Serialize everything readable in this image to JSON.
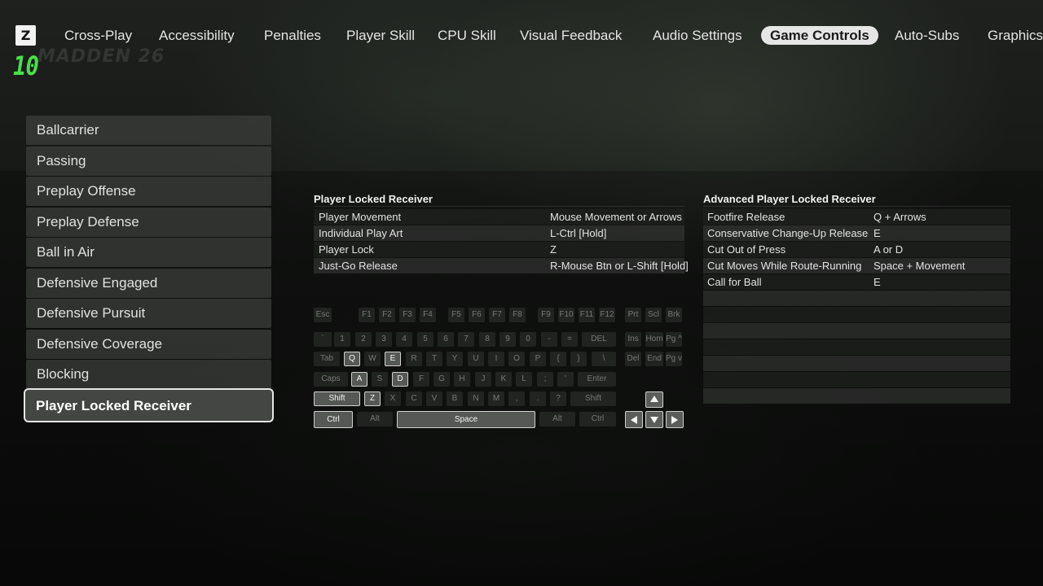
{
  "header": {
    "logo_letter": "Z",
    "score": "10",
    "brand": "MADDEN 26",
    "tabs": [
      {
        "label": "Cross-Play",
        "active": false
      },
      {
        "label": "Accessibility",
        "active": false
      },
      {
        "label": "Penalties",
        "active": false
      },
      {
        "label": "Player Skill",
        "active": false
      },
      {
        "label": "CPU Skill",
        "active": false
      },
      {
        "label": "Visual Feedback",
        "active": false
      },
      {
        "label": "Audio Settings",
        "active": false
      },
      {
        "label": "Game Controls",
        "active": true
      },
      {
        "label": "Auto-Subs",
        "active": false
      },
      {
        "label": "Graphics",
        "active": false
      }
    ]
  },
  "sidebar": {
    "items": [
      {
        "label": "Ballcarrier",
        "selected": false
      },
      {
        "label": "Passing",
        "selected": false
      },
      {
        "label": "Preplay Offense",
        "selected": false
      },
      {
        "label": "Preplay Defense",
        "selected": false
      },
      {
        "label": "Ball in Air",
        "selected": false
      },
      {
        "label": "Defensive Engaged",
        "selected": false
      },
      {
        "label": "Defensive Pursuit",
        "selected": false
      },
      {
        "label": "Defensive Coverage",
        "selected": false
      },
      {
        "label": "Blocking",
        "selected": false
      },
      {
        "label": "Player Locked Receiver",
        "selected": true
      }
    ]
  },
  "controls_main": {
    "title": "Player Locked Receiver",
    "rows": [
      {
        "action": "Player Movement",
        "binding": "Mouse Movement or Arrows"
      },
      {
        "action": "Individual Play Art",
        "binding": "L-Ctrl [Hold]"
      },
      {
        "action": "Player Lock",
        "binding": "Z"
      },
      {
        "action": "Just-Go Release",
        "binding": "R-Mouse Btn or L-Shift [Hold]"
      }
    ]
  },
  "controls_advanced": {
    "title": "Advanced Player Locked Receiver",
    "rows": [
      {
        "action": "Footfire Release",
        "binding": "Q + Arrows"
      },
      {
        "action": "Conservative Change-Up Release",
        "binding": "E"
      },
      {
        "action": "Cut Out of Press",
        "binding": "A or D"
      },
      {
        "action": "Cut Moves While Route-Running",
        "binding": "Space + Movement"
      },
      {
        "action": "Call for Ball",
        "binding": "E"
      },
      {
        "action": "",
        "binding": ""
      },
      {
        "action": "",
        "binding": ""
      },
      {
        "action": "",
        "binding": ""
      },
      {
        "action": "",
        "binding": ""
      },
      {
        "action": "",
        "binding": ""
      },
      {
        "action": "",
        "binding": ""
      },
      {
        "action": "",
        "binding": ""
      }
    ]
  },
  "keyboard": {
    "highlighted": [
      "Q",
      "E",
      "A",
      "D",
      "Shift",
      "Z",
      "Ctrl",
      "Space",
      "up",
      "left",
      "down",
      "right"
    ],
    "keys": [
      "Esc",
      "F1",
      "F2",
      "F3",
      "F4",
      "F5",
      "F6",
      "F7",
      "F8",
      "F9",
      "F10",
      "F11",
      "F12",
      "Prt",
      "Scl",
      "Brk",
      "`",
      "1",
      "2",
      "3",
      "4",
      "5",
      "6",
      "7",
      "8",
      "9",
      "0",
      "-",
      "=",
      "DEL",
      "Ins",
      "Hom",
      "Pg ^",
      "Tab",
      "Q",
      "W",
      "E",
      "R",
      "T",
      "Y",
      "U",
      "I",
      "O",
      "P",
      "{",
      "}",
      "\\",
      "Del",
      "End",
      "Pg v",
      "Caps",
      "A",
      "S",
      "D",
      "F",
      "G",
      "H",
      "J",
      "K",
      "L",
      ";",
      "'",
      "Enter",
      "Shift",
      "Z",
      "X",
      "C",
      "V",
      "B",
      "N",
      "M",
      ",",
      ".",
      "?",
      "Shift",
      "Ctrl",
      "Alt",
      "Space",
      "Alt",
      "Ctrl"
    ]
  }
}
